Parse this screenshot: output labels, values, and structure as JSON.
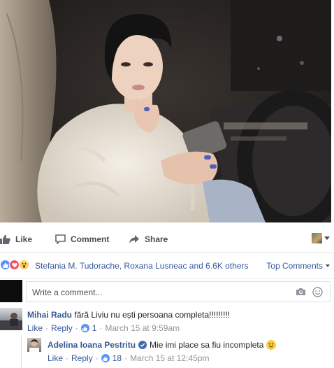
{
  "post": {
    "photo_alt": "Woman in fur coat holding phone in car"
  },
  "actions": {
    "like_label": "Like",
    "comment_label": "Comment",
    "share_label": "Share"
  },
  "reactions": {
    "names": "Stefania M. Tudorache, Roxana Lusneac and 6.6K others",
    "top_comments_label": "Top Comments"
  },
  "composer": {
    "placeholder": "Write a comment..."
  },
  "comments": [
    {
      "author": "Mihai Radu",
      "text": "fără Liviu nu ești persoana completa!!!!!!!!!",
      "like_label": "Like",
      "reply_label": "Reply",
      "likes": "1",
      "timestamp": "March 15 at 9:59am"
    },
    {
      "author": "Adelina Ioana Pestritu",
      "text": "Mie imi place sa fiu incompleta",
      "like_label": "Like",
      "reply_label": "Reply",
      "likes": "18",
      "timestamp": "March 15 at 12:45pm"
    }
  ],
  "colors": {
    "link": "#365899",
    "meta": "#90949c",
    "like_blue": "#5890ff",
    "love_red": "#f25268",
    "wow_yellow": "#fcd062"
  },
  "icons": [
    "thumbs-up-icon",
    "comment-bubble-icon",
    "share-arrow-icon",
    "camera-icon",
    "emoji-icon",
    "verified-badge-icon"
  ]
}
